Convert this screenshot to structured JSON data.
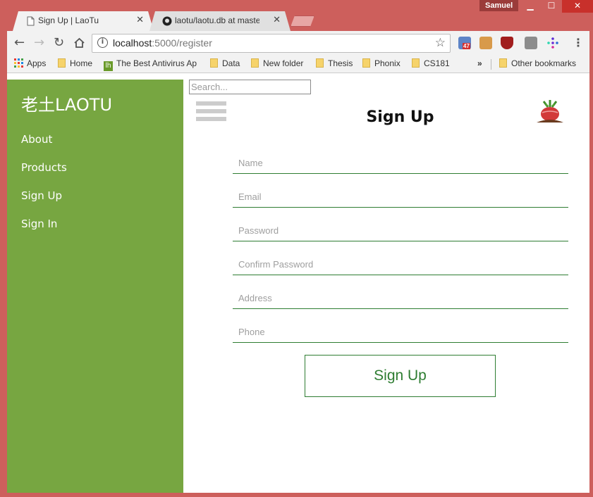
{
  "browser": {
    "tabs": [
      {
        "title": "Sign Up | LaoTu",
        "active": true
      },
      {
        "title": "laotu/laotu.db at master",
        "active": false
      }
    ],
    "user": "Samuel",
    "url_host": "localhost",
    "url_path": ":5000/register",
    "extension_badge": "47",
    "bookmarks": [
      "Apps",
      "Home",
      "The Best Antivirus Ap",
      "Data",
      "New folder",
      "Thesis",
      "Phonix",
      "CS181",
      "»",
      "Other bookmarks"
    ]
  },
  "sidebar": {
    "brand": "老土LAOTU",
    "items": [
      "About",
      "Products",
      "Sign Up",
      "Sign In"
    ],
    "background": "#77a641"
  },
  "search": {
    "placeholder": "Search..."
  },
  "form": {
    "title": "Sign Up",
    "fields": [
      {
        "placeholder": "Name"
      },
      {
        "placeholder": "Email"
      },
      {
        "placeholder": "Password"
      },
      {
        "placeholder": "Confirm Password"
      },
      {
        "placeholder": "Address"
      },
      {
        "placeholder": "Phone"
      }
    ],
    "submit_label": "Sign Up",
    "accent": "#2e7d32"
  },
  "colors": {
    "frame": "#cd5f5c"
  }
}
